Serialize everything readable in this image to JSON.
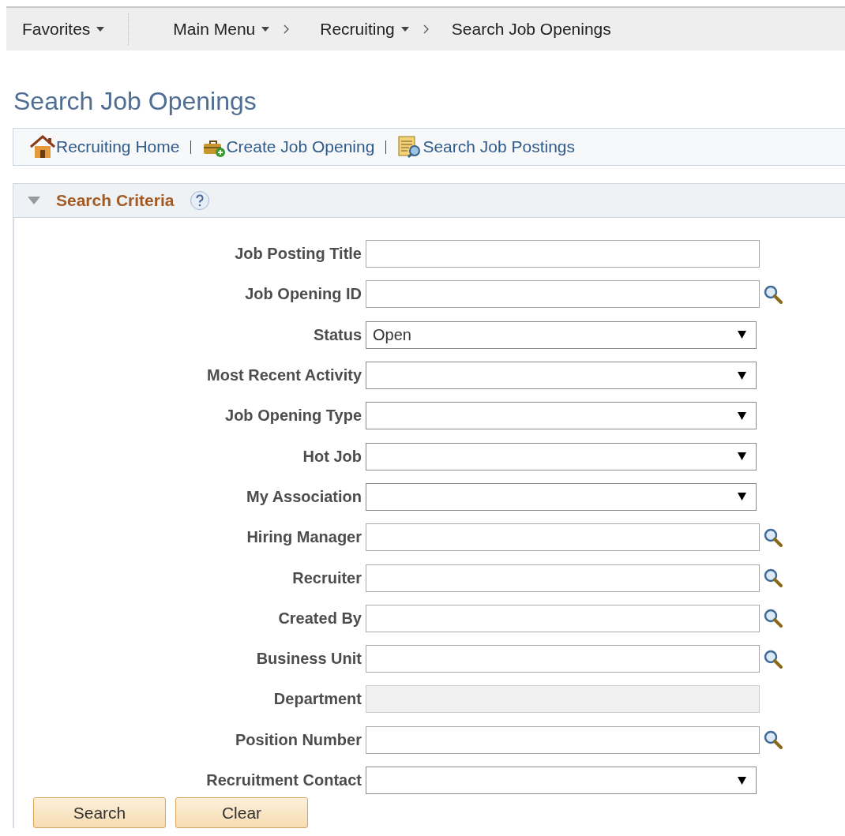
{
  "nav": {
    "items": [
      {
        "label": "Favorites",
        "kind": "menu"
      },
      {
        "label": "Main Menu",
        "kind": "menu"
      },
      {
        "label": "Recruiting",
        "kind": "crumb-menu"
      },
      {
        "label": "Search Job Openings",
        "kind": "crumb"
      }
    ]
  },
  "page_title": "Search Job Openings",
  "toolbar": {
    "links": [
      {
        "label": "Recruiting Home",
        "kind": "home"
      },
      {
        "label": "Create Job Opening",
        "kind": "create"
      },
      {
        "label": "Search Job Postings",
        "kind": "search"
      }
    ]
  },
  "section": {
    "title": "Search Criteria",
    "expanded": true,
    "fields": [
      {
        "label": "Job Posting Title",
        "kind": "text",
        "disabled": false
      },
      {
        "label": "Job Opening ID",
        "kind": "lookup",
        "disabled": false
      },
      {
        "label": "Status",
        "kind": "select",
        "value": "Open"
      },
      {
        "label": "Most Recent Activity",
        "kind": "select"
      },
      {
        "label": "Job Opening Type",
        "kind": "select"
      },
      {
        "label": "Hot Job",
        "kind": "select"
      },
      {
        "label": "My Association",
        "kind": "select"
      },
      {
        "label": "Hiring Manager",
        "kind": "lookup",
        "disabled": false
      },
      {
        "label": "Recruiter",
        "kind": "lookup",
        "disabled": false
      },
      {
        "label": "Created By",
        "kind": "lookup",
        "disabled": false
      },
      {
        "label": "Business Unit",
        "kind": "lookup",
        "disabled": false
      },
      {
        "label": "Department",
        "kind": "text",
        "disabled": true
      },
      {
        "label": "Position Number",
        "kind": "lookup",
        "disabled": false
      },
      {
        "label": "Recruitment Contact",
        "kind": "select"
      }
    ]
  },
  "buttons": [
    "Search",
    "Clear"
  ]
}
